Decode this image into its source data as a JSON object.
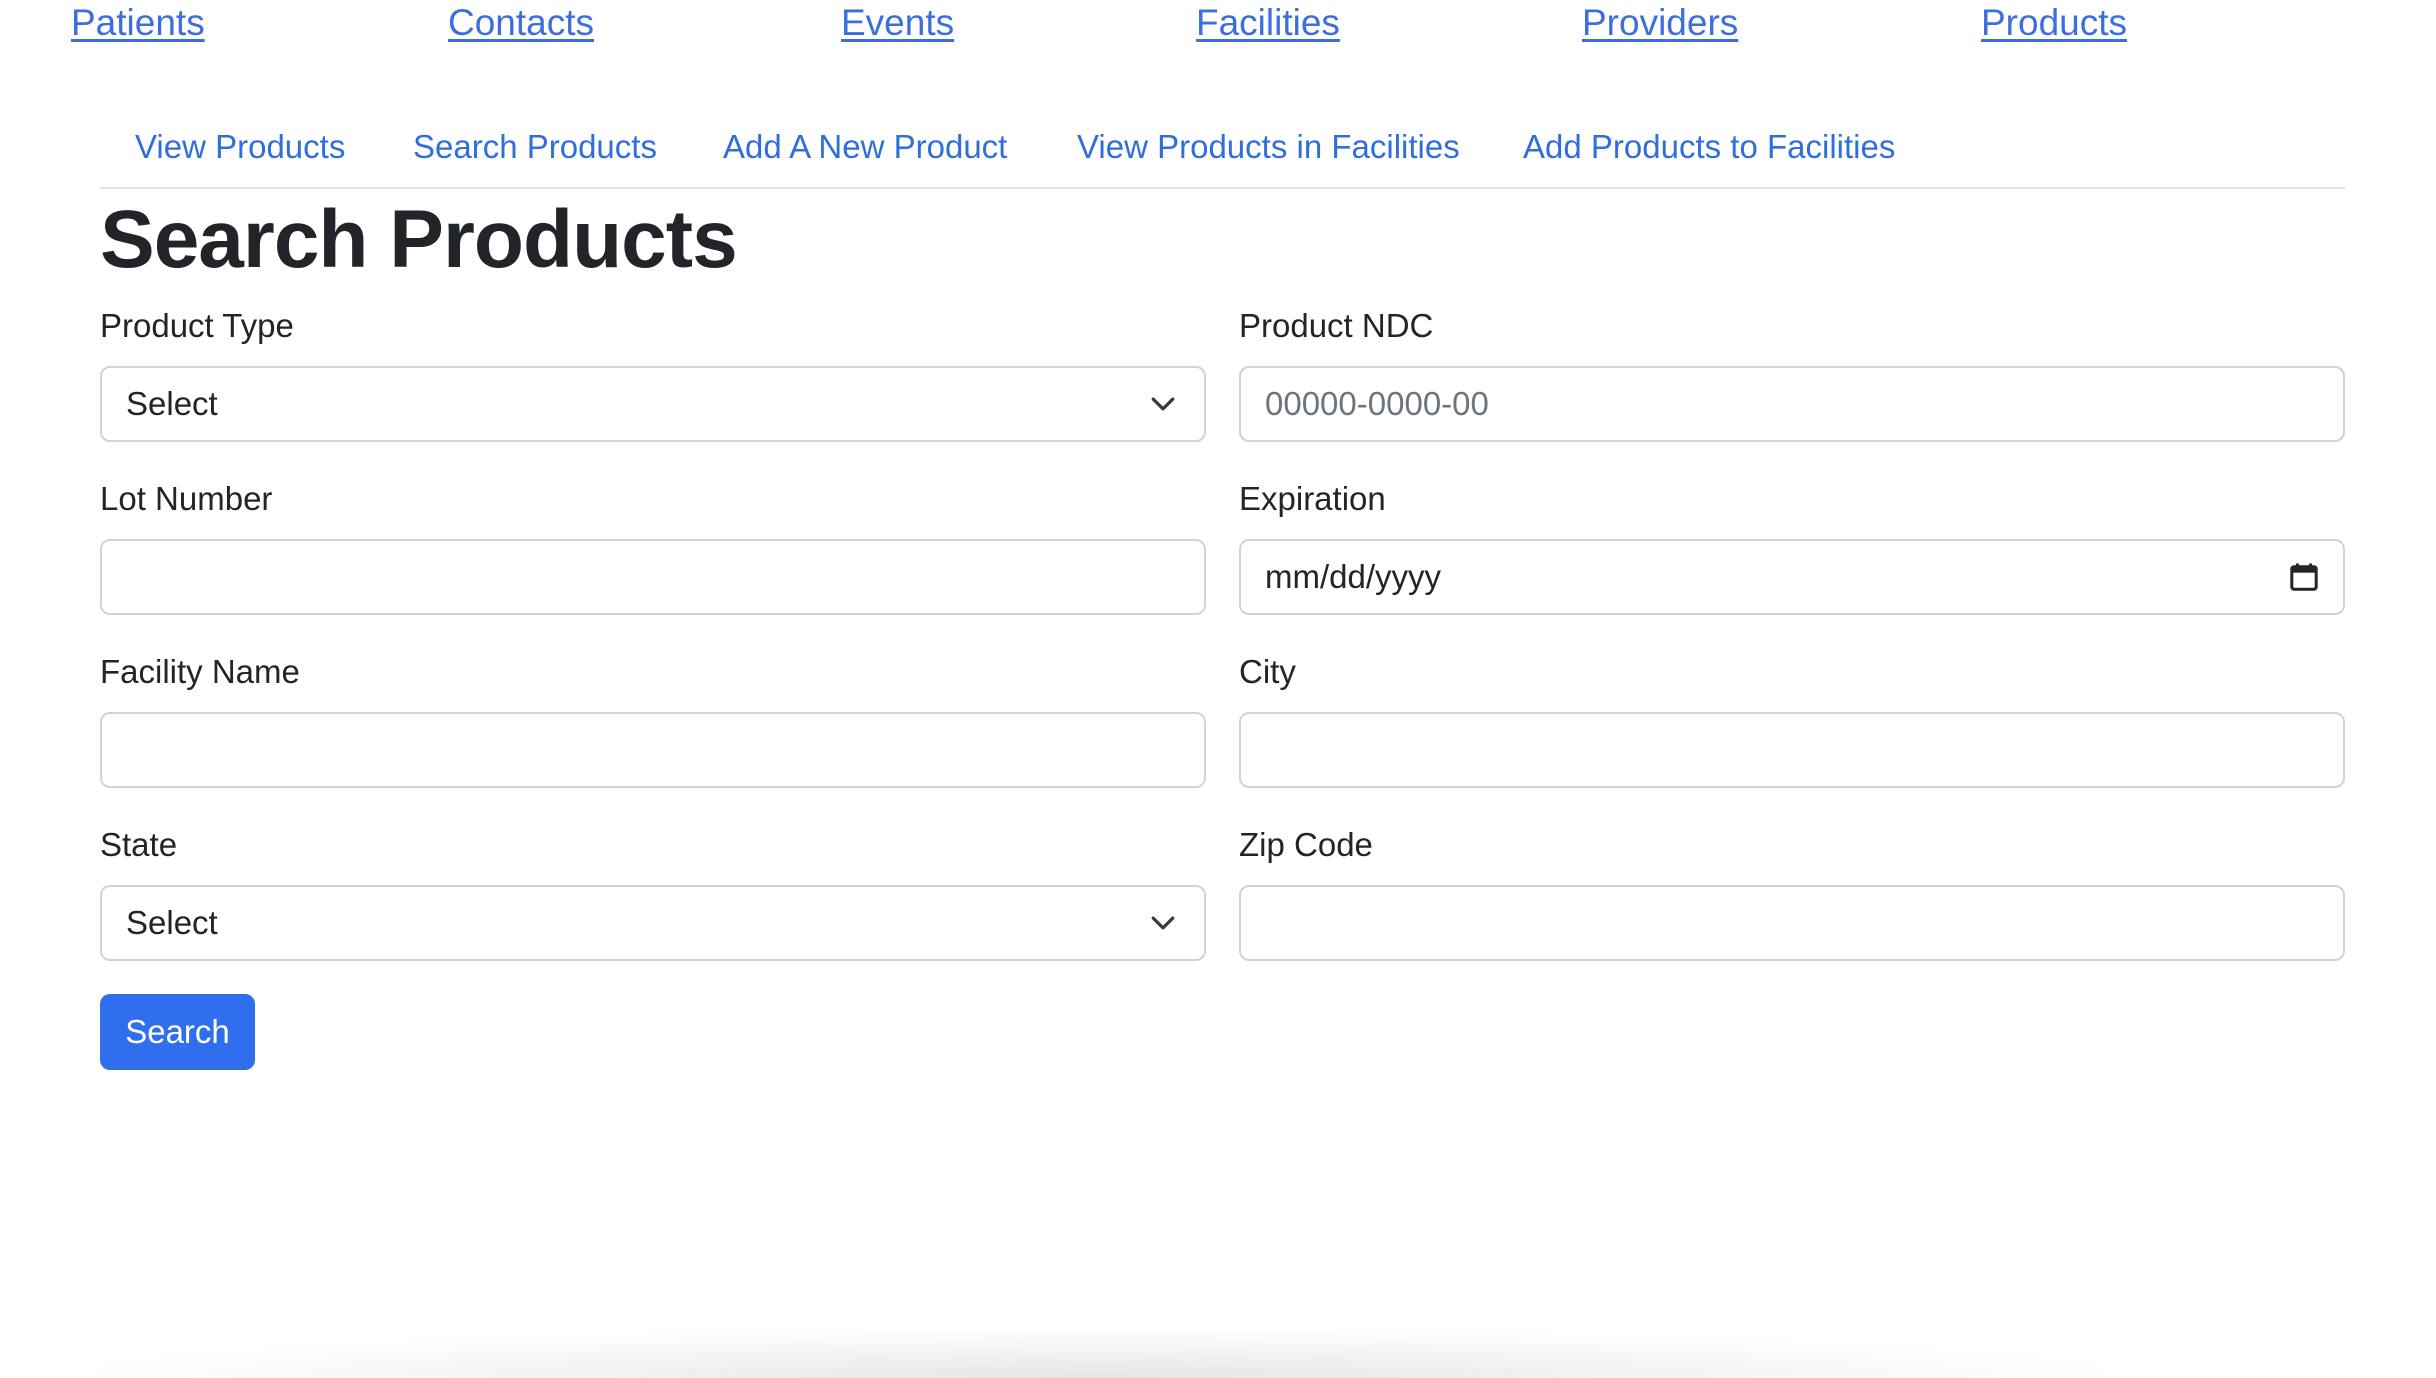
{
  "top_nav": {
    "items": [
      {
        "label": "Patients"
      },
      {
        "label": "Contacts"
      },
      {
        "label": "Events"
      },
      {
        "label": "Facilities"
      },
      {
        "label": "Providers"
      },
      {
        "label": "Products"
      }
    ]
  },
  "sub_tabs": {
    "items": [
      {
        "label": "View Products"
      },
      {
        "label": "Search Products"
      },
      {
        "label": "Add A New Product"
      },
      {
        "label": "View Products in Facilities"
      },
      {
        "label": "Add Products to Facilities"
      }
    ]
  },
  "page": {
    "title": "Search Products"
  },
  "form": {
    "product_type": {
      "label": "Product Type",
      "value": "Select"
    },
    "product_ndc": {
      "label": "Product NDC",
      "value": "",
      "placeholder": "00000-0000-00"
    },
    "lot_number": {
      "label": "Lot Number",
      "value": ""
    },
    "expiration": {
      "label": "Expiration",
      "value": "mm/dd/yyyy"
    },
    "facility_name": {
      "label": "Facility Name",
      "value": ""
    },
    "city": {
      "label": "City",
      "value": ""
    },
    "state": {
      "label": "State",
      "value": "Select"
    },
    "zip_code": {
      "label": "Zip Code",
      "value": ""
    },
    "search_label": "Search"
  },
  "icons": {
    "select_arrow": "chevron-down-icon",
    "date_picker": "calendar-icon"
  },
  "colors": {
    "link": "#3d6ee0",
    "tab_link": "#2f6fdc",
    "primary_button": "#2f6fed",
    "text": "#212529",
    "border": "#ced4da"
  }
}
